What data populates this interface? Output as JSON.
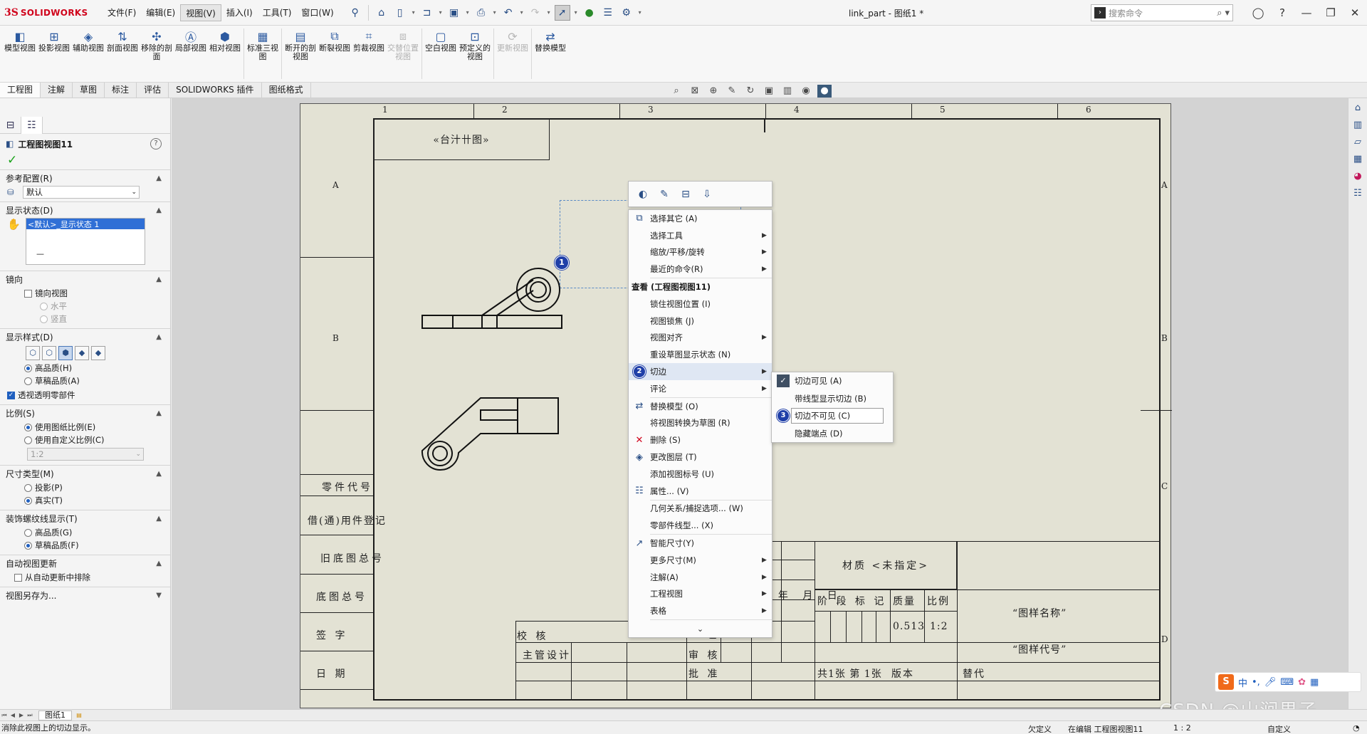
{
  "titlebar": {
    "brand_ds": "3S",
    "brand_name": "SOLIDWORKS",
    "menus": [
      "文件(F)",
      "编辑(E)",
      "视图(V)",
      "插入(I)",
      "工具(T)",
      "窗口(W)"
    ],
    "active_menu": "视图(V)",
    "document_title": "link_part - 图纸1 *",
    "search_placeholder": "搜索命令"
  },
  "command_manager": {
    "buttons": [
      {
        "label": "模型视图",
        "icon": "model-view-icon",
        "enabled": true
      },
      {
        "label": "投影视图",
        "icon": "projected-view-icon",
        "enabled": true
      },
      {
        "label": "辅助视图",
        "icon": "auxiliary-view-icon",
        "enabled": true
      },
      {
        "label": "剖面视图",
        "icon": "section-view-icon",
        "enabled": true
      },
      {
        "label": "移除的剖面",
        "icon": "removed-section-icon",
        "enabled": true
      },
      {
        "label": "局部视图",
        "icon": "detail-view-icon",
        "enabled": true
      },
      {
        "label": "相对视图",
        "icon": "relative-view-icon",
        "enabled": true
      },
      {
        "label": "标准三视图",
        "icon": "standard-3-view-icon",
        "enabled": true
      },
      {
        "label": "断开的剖视图",
        "icon": "broken-out-section-icon",
        "enabled": true
      },
      {
        "label": "断裂视图",
        "icon": "break-view-icon",
        "enabled": true
      },
      {
        "label": "剪裁视图",
        "icon": "crop-view-icon",
        "enabled": true
      },
      {
        "label": "交替位置视图",
        "icon": "alternate-position-view-icon",
        "enabled": false
      },
      {
        "label": "空白视图",
        "icon": "empty-view-icon",
        "enabled": true
      },
      {
        "label": "预定义的视图",
        "icon": "predefined-view-icon",
        "enabled": true
      },
      {
        "label": "更新视图",
        "icon": "update-view-icon",
        "enabled": false
      },
      {
        "label": "替换模型",
        "icon": "replace-model-icon",
        "enabled": true
      }
    ]
  },
  "tabs": [
    "工程图",
    "注解",
    "草图",
    "标注",
    "评估",
    "SOLIDWORKS 插件",
    "图纸格式"
  ],
  "active_tab": "工程图",
  "property_manager": {
    "title": "工程图视图11",
    "groups": {
      "ref_config": {
        "title": "参考配置(R)",
        "value": "默认"
      },
      "display_state": {
        "title": "显示状态(D)",
        "selected": "<默认>_显示状态 1",
        "dash": "—"
      },
      "mirror": {
        "title": "镜向",
        "checkbox": "镜向视图",
        "options": [
          "水平",
          "竖直"
        ]
      },
      "display_style": {
        "title": "显示样式(D)",
        "quality": [
          "高品质(H)",
          "草稿品质(A)"
        ],
        "transparent": "透视透明零部件"
      },
      "scale": {
        "title": "比例(S)",
        "options": [
          "使用图纸比例(E)",
          "使用自定义比例(C)"
        ],
        "custom_value": "1:2"
      },
      "dim_type": {
        "title": "尺寸类型(M)",
        "options": [
          "投影(P)",
          "真实(T)"
        ]
      },
      "cosmetic_thread": {
        "title": "装饰螺纹线显示(T)",
        "options": [
          "高品质(G)",
          "草稿品质(F)"
        ]
      },
      "auto_update": {
        "title": "自动视图更新",
        "checkbox": "从自动更新中排除"
      },
      "save_as": {
        "title": "视图另存为..."
      }
    }
  },
  "sheet": {
    "zones_top": [
      "1",
      "2",
      "3",
      "4",
      "5",
      "6"
    ],
    "zones_side": [
      "A",
      "B",
      "C",
      "D"
    ],
    "code_box": "«台汁卄图»",
    "left_block": [
      "零件代号",
      "借(通)用件登记",
      "旧底图总号",
      "底图总号",
      "签  字",
      "日  期"
    ],
    "title_block": {
      "material": "材质 <未指定>",
      "headers": [
        "阶 段 标 记",
        "质量",
        "比例"
      ],
      "mass": "0.513",
      "scale": "1:2",
      "drawing_name": "“图样名称”",
      "drawing_code": "“图样代号”",
      "sheets": "共1张 第 1张",
      "version": "版本",
      "replace": "替代",
      "sign_headers": "签 名 年 月 日",
      "roles": [
        "校 核",
        "主管设计",
        "审 核",
        "批 准",
        "工 艺"
      ]
    }
  },
  "context_toolbar_icons": [
    "view-properties-icon",
    "hide-icon",
    "align-icon",
    "lock-icon"
  ],
  "context_menu": {
    "items": [
      {
        "label": "选择其它 (A)",
        "icon": "select-other-icon",
        "arrow": false
      },
      {
        "label": "选择工具",
        "icon": "",
        "arrow": true
      },
      {
        "label": "缩放/平移/旋转",
        "icon": "",
        "arrow": true
      },
      {
        "label": "最近的命令(R)",
        "icon": "",
        "arrow": true
      },
      {
        "label": "查看 (工程图视图11)",
        "header": true
      },
      {
        "label": "锁住视图位置 (I)",
        "icon": "",
        "arrow": false
      },
      {
        "label": "视图锁焦 (J)",
        "icon": "",
        "arrow": false
      },
      {
        "label": "视图对齐",
        "icon": "",
        "arrow": true
      },
      {
        "label": "重设草图显示状态 (N)",
        "icon": "",
        "arrow": false
      },
      {
        "label": "切边",
        "icon": "",
        "arrow": true,
        "highlight": true
      },
      {
        "label": "评论",
        "icon": "",
        "arrow": true
      },
      {
        "label": "替换模型 (O)",
        "icon": "replace-model-icon",
        "arrow": false
      },
      {
        "label": "将视图转换为草图 (R)",
        "icon": "",
        "arrow": false
      },
      {
        "label": "删除 (S)",
        "icon": "delete-icon",
        "arrow": false
      },
      {
        "label": "更改图层 (T)",
        "icon": "layer-icon",
        "arrow": false
      },
      {
        "label": "添加视图标号 (U)",
        "icon": "",
        "arrow": false
      },
      {
        "label": "属性... (V)",
        "icon": "properties-icon",
        "arrow": false
      },
      {
        "label": "几何关系/捕捉选项... (W)",
        "icon": "",
        "arrow": false
      },
      {
        "label": "零部件线型... (X)",
        "icon": "",
        "arrow": false
      },
      {
        "label": "智能尺寸(Y)",
        "icon": "smart-dimension-icon",
        "arrow": false
      },
      {
        "label": "更多尺寸(M)",
        "icon": "",
        "arrow": true
      },
      {
        "label": "注解(A)",
        "icon": "",
        "arrow": true
      },
      {
        "label": "工程视图",
        "icon": "",
        "arrow": true
      },
      {
        "label": "表格",
        "icon": "",
        "arrow": true
      }
    ],
    "more": "⌄"
  },
  "submenu": {
    "items": [
      {
        "label": "切边可见 (A)",
        "checked": true
      },
      {
        "label": "带线型显示切边 (B)",
        "checked": false
      },
      {
        "label": "切边不可见 (C)",
        "checked": false,
        "highlight": true
      },
      {
        "label": "隐藏端点 (D)",
        "checked": false
      }
    ]
  },
  "badges": [
    "1",
    "2",
    "3"
  ],
  "sheet_tab": "图纸1",
  "statusbar": {
    "message": "消除此视图上的切边显示。",
    "undefined": "欠定义",
    "editing": "在编辑 工程图视图11",
    "scale": "1 : 2",
    "custom": "自定义"
  },
  "watermark": "CSDN @山涧果子",
  "ime": {
    "logo": "S",
    "lang": "中"
  }
}
